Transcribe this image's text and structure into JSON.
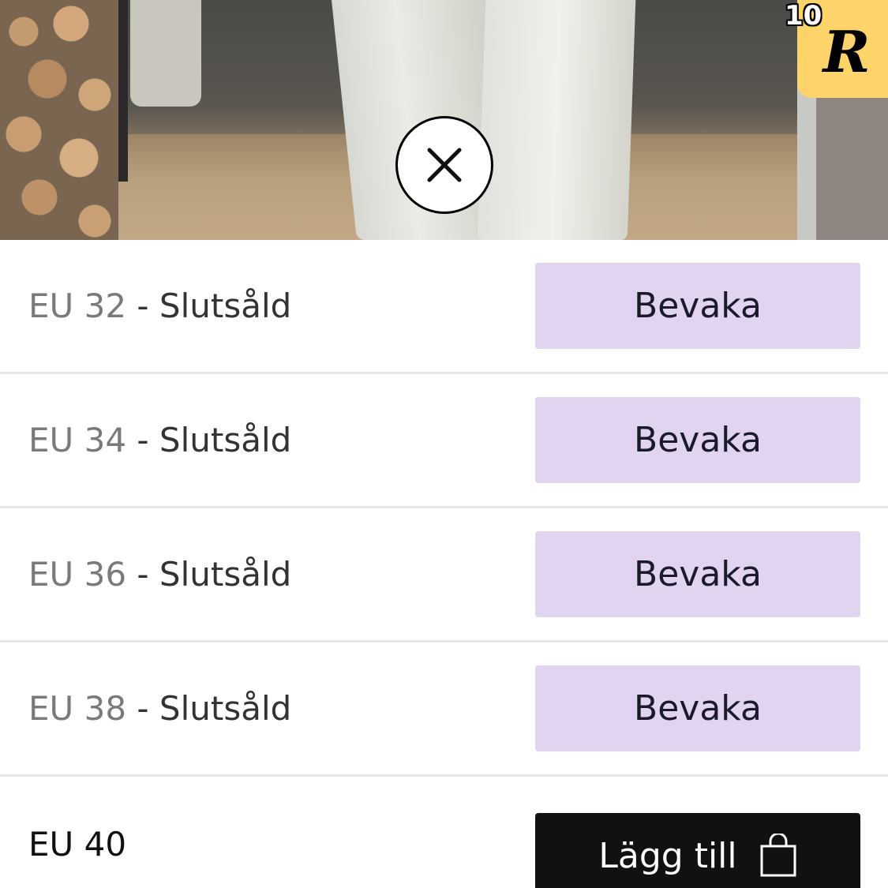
{
  "photo": {
    "description_icon": "product-photo"
  },
  "badge": {
    "count": "10",
    "letter": "R"
  },
  "close": {
    "icon": "close-icon"
  },
  "sizes": [
    {
      "size": "EU 32",
      "status": " - Slutsåld",
      "action": "Bevaka"
    },
    {
      "size": "EU 34",
      "status": " - Slutsåld",
      "action": "Bevaka"
    },
    {
      "size": "EU 36",
      "status": " - Slutsåld",
      "action": "Bevaka"
    },
    {
      "size": "EU 38",
      "status": " - Slutsåld",
      "action": "Bevaka"
    },
    {
      "size": "EU 40",
      "status": "",
      "action": "Lägg till"
    }
  ],
  "colors": {
    "watch_button_bg": "#e0d4f0",
    "add_button_bg": "#111111",
    "badge_bg": "#fcd46a"
  }
}
